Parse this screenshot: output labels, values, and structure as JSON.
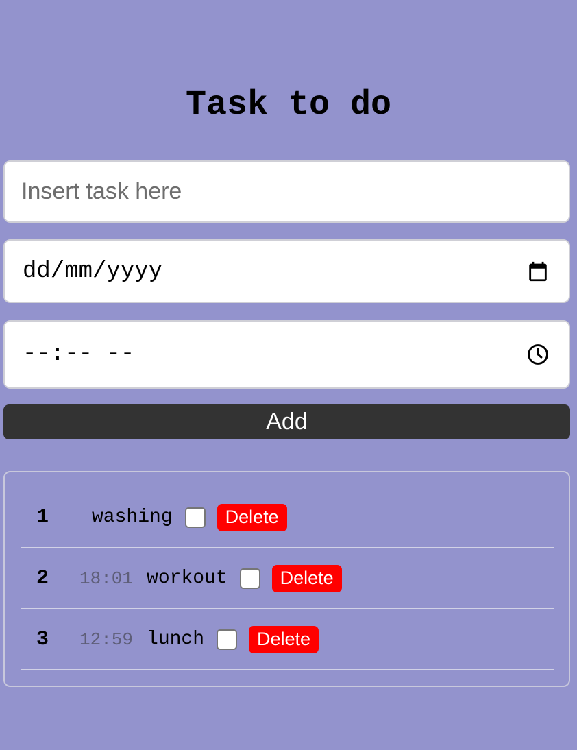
{
  "title": "Task to do",
  "form": {
    "task_placeholder": "Insert task here",
    "task_value": "",
    "date_display": "dd/mm/yyyy",
    "time_display": "--:-- --",
    "add_label": "Add"
  },
  "tasks": [
    {
      "num": "1",
      "time": "",
      "name": "washing",
      "checked": false,
      "delete_label": "Delete"
    },
    {
      "num": "2",
      "time": "18:01",
      "name": "workout",
      "checked": false,
      "delete_label": "Delete"
    },
    {
      "num": "3",
      "time": "12:59",
      "name": "lunch",
      "checked": false,
      "delete_label": "Delete"
    }
  ],
  "icons": {
    "date": "calendar-icon",
    "time": "clock-icon"
  },
  "colors": {
    "background": "#9393cd",
    "add_button": "#333333",
    "delete_button": "#ff0000",
    "time_text": "#5e5e78"
  }
}
